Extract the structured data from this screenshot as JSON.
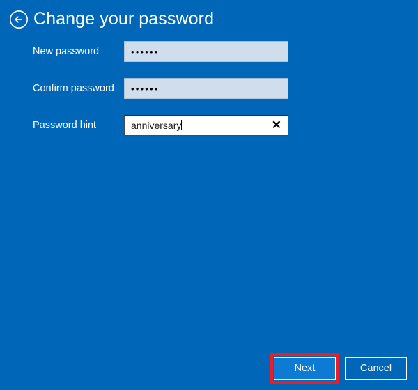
{
  "window": {
    "background_color": "#0067b8",
    "title": "Change your password"
  },
  "header": {
    "back_icon": "back-arrow-circle-icon",
    "title": "Change your password"
  },
  "form": {
    "fields": [
      {
        "label": "New password",
        "value": "••••••",
        "masked": true,
        "char_count": 6,
        "focused": false,
        "has_clear_button": false,
        "background_color": "#cfdded"
      },
      {
        "label": "Confirm password",
        "value": "••••••",
        "masked": true,
        "char_count": 6,
        "focused": false,
        "has_clear_button": false,
        "background_color": "#cfdded"
      },
      {
        "label": "Password hint",
        "value": "anniversary",
        "masked": false,
        "focused": true,
        "has_clear_button": true,
        "clear_icon": "close-x-icon",
        "clear_icon_glyph": "✕",
        "background_color": "#ffffff"
      }
    ]
  },
  "footer": {
    "next_label": "Next",
    "cancel_label": "Cancel",
    "next_background_color": "#0d7bd4",
    "cancel_background_color": "#0067b8"
  },
  "annotation": {
    "highlight_color": "#ee1c25",
    "highlight_target": "Next"
  }
}
